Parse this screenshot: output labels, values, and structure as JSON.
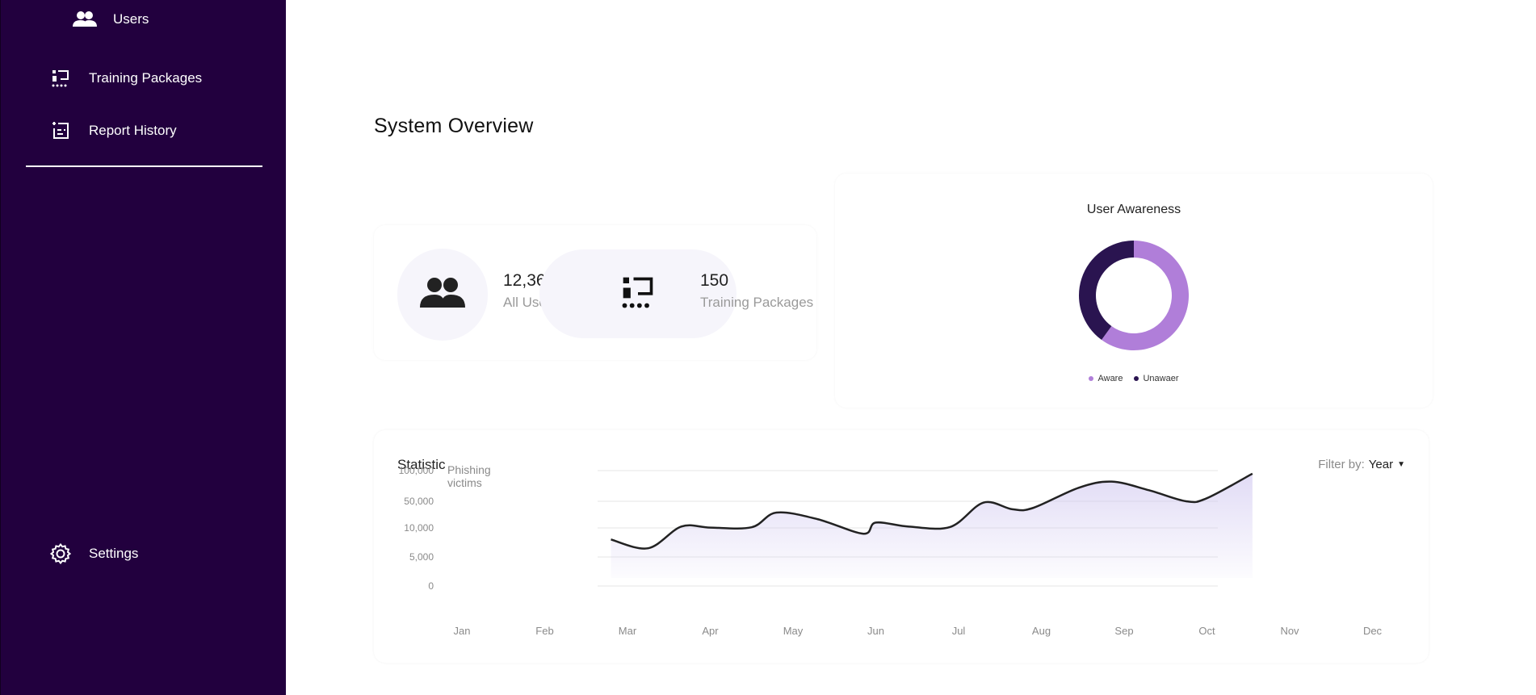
{
  "sidebar": {
    "items": [
      {
        "label": "Users",
        "icon": "users-icon"
      },
      {
        "label": "Training Packages",
        "icon": "training-packages-icon"
      },
      {
        "label": "Report History",
        "icon": "report-history-icon"
      }
    ],
    "settings_label": "Settings"
  },
  "page_title": "System Overview",
  "stats": [
    {
      "value": "12,365",
      "label": "All Users",
      "icon": "users-icon"
    },
    {
      "value": "150",
      "label": "Training Packages",
      "icon": "training-packages-icon"
    }
  ],
  "awareness": {
    "title": "User Awareness",
    "legend": [
      {
        "label": "Aware",
        "color": "#b07ed9"
      },
      {
        "label": "Unawaer",
        "color": "#2a1450"
      }
    ]
  },
  "statistic": {
    "title": "Statistic",
    "filter_label": "Filter by:",
    "filter_value": "Year"
  },
  "colors": {
    "sidebar_bg": "#22003e",
    "accent_light": "#b07ed9",
    "accent_dark": "#2a1450",
    "line": "#222222"
  },
  "chart_data": [
    {
      "type": "pie",
      "title": "User Awareness",
      "labels": [
        "Aware",
        "Unawaer"
      ],
      "values": [
        60,
        40
      ],
      "colors": [
        "#b07ed9",
        "#2a1450"
      ],
      "legend": "bottom"
    },
    {
      "type": "area",
      "title": "Statistic",
      "ylabel": "Phishing victims",
      "yticks": [
        "0",
        "5,000",
        "10,000",
        "50,000",
        "100,000"
      ],
      "xticks": [
        "Jan",
        "Feb",
        "Mar",
        "Apr",
        "May",
        "Jun",
        "Jul",
        "Aug",
        "Sep",
        "Oct",
        "Nov",
        "Dec"
      ],
      "x": [
        2.8,
        3.25,
        3.65,
        4.0,
        4.5,
        4.8,
        5.3,
        5.85,
        6.0,
        6.4,
        6.9,
        7.3,
        7.65,
        7.9,
        8.45,
        8.85,
        9.3,
        9.75,
        10.0,
        10.55
      ],
      "y": [
        8000,
        6500,
        12000,
        10500,
        11000,
        33000,
        23000,
        9000,
        18000,
        12000,
        11500,
        48000,
        38000,
        40000,
        72000,
        82000,
        68000,
        50000,
        55000,
        95000
      ],
      "grid": true,
      "legend": "none"
    }
  ]
}
